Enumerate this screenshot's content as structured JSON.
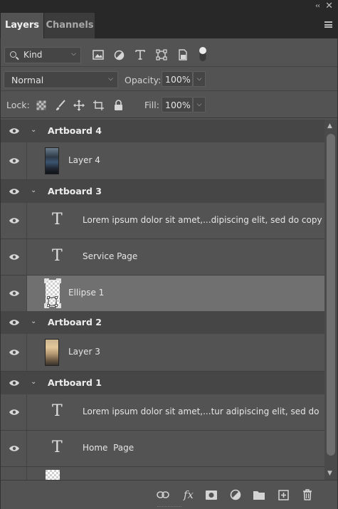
{
  "window": {
    "collapse_label": "‹‹",
    "close_label": "✕"
  },
  "tabs": [
    {
      "label": "Layers",
      "active": true
    },
    {
      "label": "Channels",
      "active": false
    }
  ],
  "filter": {
    "kind_label": "Kind",
    "filter_icons": [
      "image-filter-icon",
      "adjustment-filter-icon",
      "type-filter-icon",
      "shape-filter-icon",
      "smart-object-filter-icon",
      "filter-toggle-icon"
    ]
  },
  "blend": {
    "mode": "Normal",
    "opacity_label": "Opacity:",
    "opacity_value": "100%"
  },
  "lock": {
    "label": "Lock:",
    "icons": [
      "lock-transparent-icon",
      "lock-image-icon",
      "lock-position-icon",
      "lock-artboard-icon",
      "lock-all-icon"
    ],
    "fill_label": "Fill:",
    "fill_value": "100%"
  },
  "layers": [
    {
      "kind": "group",
      "name": "Artboard 4"
    },
    {
      "kind": "image",
      "name": "Layer 4",
      "thumb": "dark-photo"
    },
    {
      "kind": "group",
      "name": "Artboard 3"
    },
    {
      "kind": "text",
      "name": "Lorem ipsum dolor sit amet,...dipiscing elit, sed do copy"
    },
    {
      "kind": "text",
      "name": "Service Page"
    },
    {
      "kind": "shape",
      "name": "Ellipse 1",
      "selected": true
    },
    {
      "kind": "group",
      "name": "Artboard 2"
    },
    {
      "kind": "image",
      "name": "Layer 3",
      "thumb": "light-photo"
    },
    {
      "kind": "group",
      "name": "Artboard 1"
    },
    {
      "kind": "text",
      "name": "Lorem ipsum dolor sit amet,...tur adipiscing elit, sed do"
    },
    {
      "kind": "text",
      "name": "Home  Page"
    },
    {
      "kind": "shape",
      "name": ""
    }
  ],
  "bottom_icons": [
    "link-layers-icon",
    "fx-icon",
    "add-mask-icon",
    "adjustment-layer-icon",
    "new-group-icon",
    "new-layer-icon",
    "delete-icon"
  ],
  "colors": {
    "panel_bg": "#535353",
    "group_row_bg": "#464646",
    "selected_row_bg": "#707070",
    "tabbar_bg": "#282828"
  }
}
